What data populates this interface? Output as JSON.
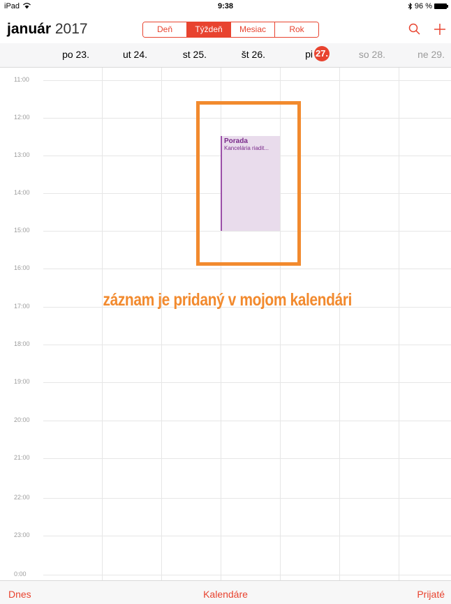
{
  "status": {
    "device": "iPad",
    "time": "9:38",
    "battery": "96 %"
  },
  "header": {
    "month": "január",
    "year": "2017",
    "segments": [
      "Deň",
      "Týždeň",
      "Mesiac",
      "Rok"
    ],
    "active_segment": "Týždeň",
    "search_icon": "search-icon",
    "add_icon": "plus-icon",
    "accent_color": "#e8432f"
  },
  "days": [
    {
      "label": "po 23."
    },
    {
      "label": "ut 24."
    },
    {
      "label": "st 25."
    },
    {
      "label": "št 26."
    },
    {
      "label": "pi",
      "number": "27."
    },
    {
      "label": "so 28."
    },
    {
      "label": "ne 29."
    }
  ],
  "hours": [
    "11:00",
    "12:00",
    "13:00",
    "14:00",
    "15:00",
    "16:00",
    "17:00",
    "18:00",
    "19:00",
    "20:00",
    "21:00",
    "22:00",
    "23:00",
    "0:00"
  ],
  "event": {
    "title": "Porada",
    "location": "Kancelária riadit...",
    "color": "#9b4fa8"
  },
  "annotation": "záznam je pridaný v mojom kalendári",
  "toolbar": {
    "today": "Dnes",
    "calendars": "Kalendáre",
    "inbox": "Prijaté"
  }
}
